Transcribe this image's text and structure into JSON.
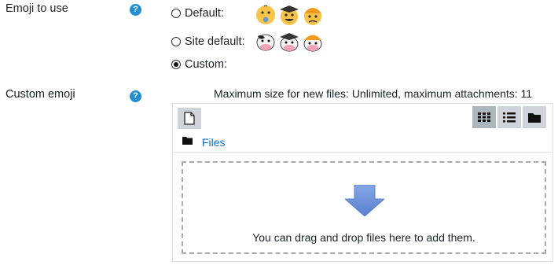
{
  "emoji_setting": {
    "label": "Emoji to use",
    "help_icon": "question-circle-icon",
    "options": [
      {
        "label": "Default:",
        "checked": false,
        "emojis": [
          "baby-face-emoji",
          "graduate-face-emoji",
          "construction-worker-face-emoji"
        ]
      },
      {
        "label": "Site default:",
        "checked": false,
        "emojis": [
          "cow-emoji",
          "cow-graduate-emoji",
          "cow-worker-emoji"
        ]
      },
      {
        "label": "Custom:",
        "checked": true,
        "emojis": []
      }
    ]
  },
  "custom_emoji": {
    "label": "Custom emoji",
    "help_icon": "question-circle-icon",
    "max_size_text": "Maximum size for new files: Unlimited, maximum attachments: 11",
    "toolbar": {
      "add_file_icon": "file-icon",
      "view_icons": [
        "grid-icon",
        "list-icon",
        "folder-icon"
      ],
      "active_view": "grid-icon"
    },
    "path": {
      "icon": "folder-icon",
      "label": "Files"
    },
    "dropzone_text": "You can drag and drop files here to add them."
  },
  "colors": {
    "accent": "#0f6cbf",
    "help": "#1f8fd6",
    "arrow": "#6f93d9"
  }
}
